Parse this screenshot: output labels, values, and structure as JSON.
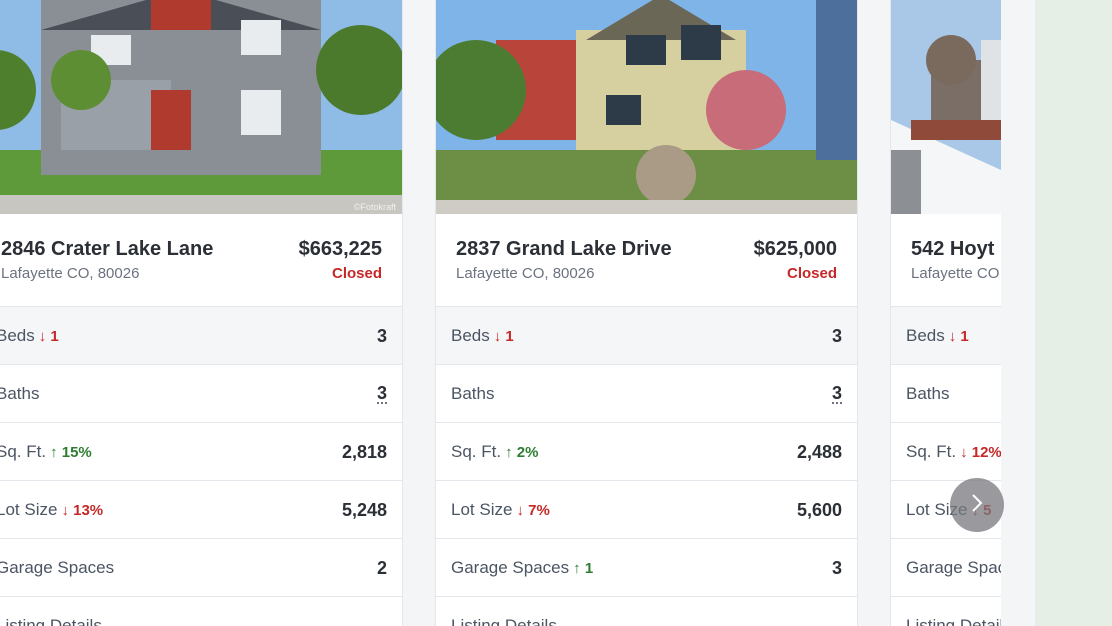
{
  "listings": [
    {
      "address": "2846 Crater Lake Lane",
      "city": "Lafayette CO, 80026",
      "price": "$663,225",
      "status": "Closed",
      "watermark": "©Fotokraft",
      "rows": [
        {
          "label": "Beds",
          "delta": "1",
          "dir": "down",
          "value": "3"
        },
        {
          "label": "Baths",
          "delta": "",
          "dir": "",
          "value": "3"
        },
        {
          "label": "Sq. Ft.",
          "delta": "15%",
          "dir": "up",
          "value": "2,818"
        },
        {
          "label": "Lot Size",
          "delta": "13%",
          "dir": "down",
          "value": "5,248"
        },
        {
          "label": "Garage Spaces",
          "delta": "",
          "dir": "",
          "value": "2"
        },
        {
          "label": "Listing Details",
          "delta": "",
          "dir": "",
          "value": ""
        }
      ]
    },
    {
      "address": "2837 Grand Lake Drive",
      "city": "Lafayette CO, 80026",
      "price": "$625,000",
      "status": "Closed",
      "watermark": "",
      "rows": [
        {
          "label": "Beds",
          "delta": "1",
          "dir": "down",
          "value": "3"
        },
        {
          "label": "Baths",
          "delta": "",
          "dir": "",
          "value": "3"
        },
        {
          "label": "Sq. Ft.",
          "delta": "2%",
          "dir": "up",
          "value": "2,488"
        },
        {
          "label": "Lot Size",
          "delta": "7%",
          "dir": "down",
          "value": "5,600"
        },
        {
          "label": "Garage Spaces",
          "delta": "1",
          "dir": "up",
          "value": "3"
        },
        {
          "label": "Listing Details",
          "delta": "",
          "dir": "",
          "value": ""
        }
      ]
    },
    {
      "address": "542 Hoyt",
      "city": "Lafayette CO",
      "price": "",
      "status": "",
      "watermark": "",
      "rows": [
        {
          "label": "Beds",
          "delta": "1",
          "dir": "down",
          "value": ""
        },
        {
          "label": "Baths",
          "delta": "",
          "dir": "",
          "value": ""
        },
        {
          "label": "Sq. Ft.",
          "delta": "12%",
          "dir": "down",
          "value": ""
        },
        {
          "label": "Lot Size",
          "delta": "5",
          "dir": "down",
          "value": ""
        },
        {
          "label": "Garage Spaces",
          "delta": "",
          "dir": "",
          "value": ""
        },
        {
          "label": "Listing Details",
          "delta": "",
          "dir": "",
          "value": ""
        }
      ]
    }
  ],
  "icons": {
    "next": "chevron-right-icon",
    "up": "arrow-up-icon",
    "down": "arrow-down-icon"
  },
  "colors": {
    "status_closed": "#c62828",
    "delta_down": "#c62828",
    "delta_up": "#2e7d32",
    "side_panel": "#e6efe5"
  }
}
